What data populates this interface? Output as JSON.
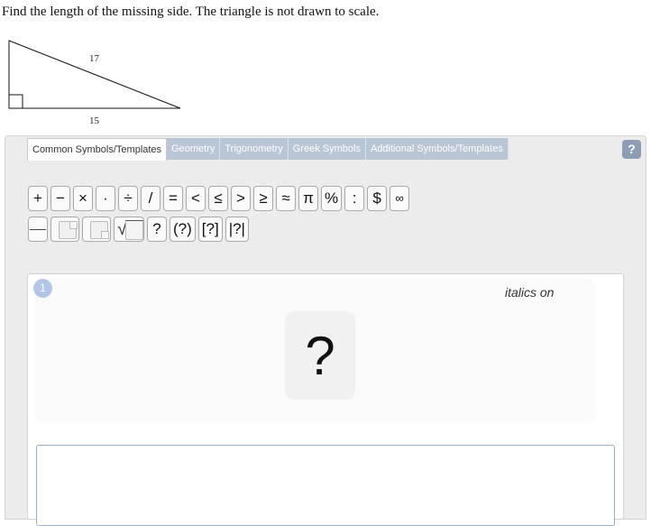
{
  "question": "Find the length of the missing side. The triangle is not drawn to scale.",
  "triangle": {
    "hypotenuse_label": "17",
    "base_label": "15"
  },
  "tabs": [
    {
      "label": "Common Symbols/Templates"
    },
    {
      "label": "Geometry"
    },
    {
      "label": "Trigonometry"
    },
    {
      "label": "Greek Symbols"
    },
    {
      "label": "Additional Symbols/Templates"
    }
  ],
  "help": "?",
  "symbols_row1": [
    "+",
    "−",
    "×",
    "·",
    "÷",
    "/",
    "=",
    "<",
    "≤",
    ">",
    "≥",
    "≈",
    "π",
    "%",
    ":",
    "$",
    "∞"
  ],
  "symbols_row2": [
    "?",
    "(?)",
    "[?]",
    "|?|"
  ],
  "answer": {
    "badge": "1",
    "italics_status": "italics on",
    "placeholder": "?"
  }
}
